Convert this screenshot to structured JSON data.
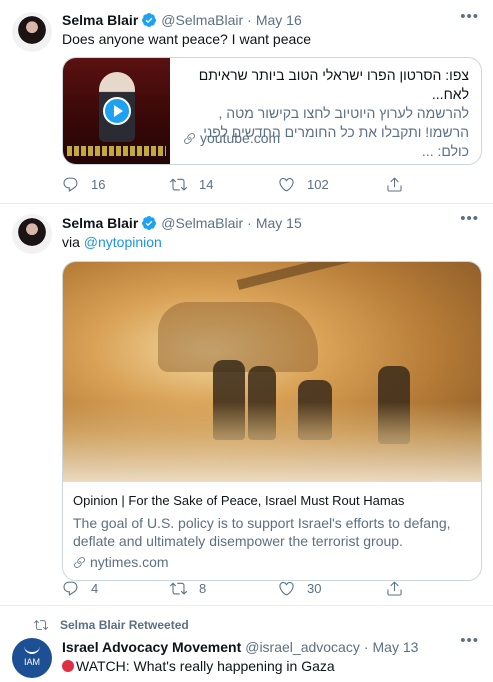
{
  "tweets": [
    {
      "author_name": "Selma Blair",
      "handle": "@SelmaBlair",
      "date": "May 16",
      "text": "Does anyone want peace? I want peace",
      "card": {
        "title": "צפו: הסרטון הפרו ישראלי הטוב ביותר שראיתם לאח...",
        "description": "להרשמה לערוץ היוטיוב לחצו בקישור מטה , הרשמו! ותקבלו את כל החומרים החדשים לפני כולם: ...",
        "domain": "youtube.com"
      },
      "replies": "16",
      "retweets": "14",
      "likes": "102"
    },
    {
      "author_name": "Selma Blair",
      "handle": "@SelmaBlair",
      "date": "May 15",
      "text_prefix": "via",
      "mention": "@nytopinion",
      "card": {
        "title": "Opinion | For the Sake of Peace, Israel Must Rout Hamas",
        "description": "The goal of U.S. policy is to support Israel's efforts to defang, deflate and ultimately disempower the terrorist group.",
        "domain": "nytimes.com"
      },
      "replies": "4",
      "retweets": "8",
      "likes": "30"
    },
    {
      "retweeted_by": "Selma Blair Retweeted",
      "author_name": "Israel Advocacy Movement",
      "handle": "@israel_advocacy",
      "date": "May 13",
      "avatar_text": "IAM",
      "text": "WATCH: What's really happening in Gaza"
    }
  ],
  "colors": {
    "accent": "#1da1f2",
    "link": "#1b95e0",
    "muted": "#5b7083",
    "border": "#e6ecf0"
  },
  "icons": [
    "verified-badge-icon",
    "more-icon",
    "reply-icon",
    "retweet-icon",
    "like-icon",
    "share-icon",
    "link-icon",
    "play-icon"
  ]
}
